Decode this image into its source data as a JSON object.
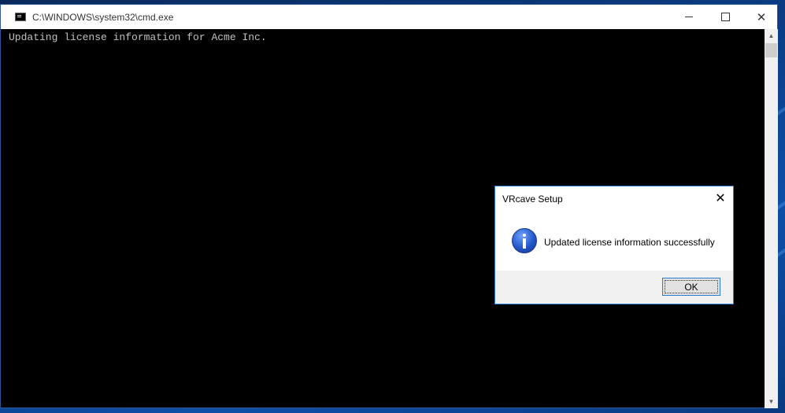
{
  "cmd_window": {
    "title": "C:\\WINDOWS\\system32\\cmd.exe",
    "icon": "console-icon",
    "output_line": "Updating license information for Acme Inc.",
    "controls": {
      "minimize": "minimize-icon",
      "maximize": "maximize-icon",
      "close": "✕"
    }
  },
  "dialog": {
    "title": "VRcave Setup",
    "close_glyph": "✕",
    "icon": "info-icon",
    "message": "Updated license information successfully",
    "ok_label": "OK"
  },
  "scrollbar": {
    "up": "▲",
    "down": "▼"
  },
  "colors": {
    "console_bg": "#000000",
    "console_text": "#c0c0c0",
    "accent": "#2b7bd9",
    "desktop": "#0b3d86"
  }
}
